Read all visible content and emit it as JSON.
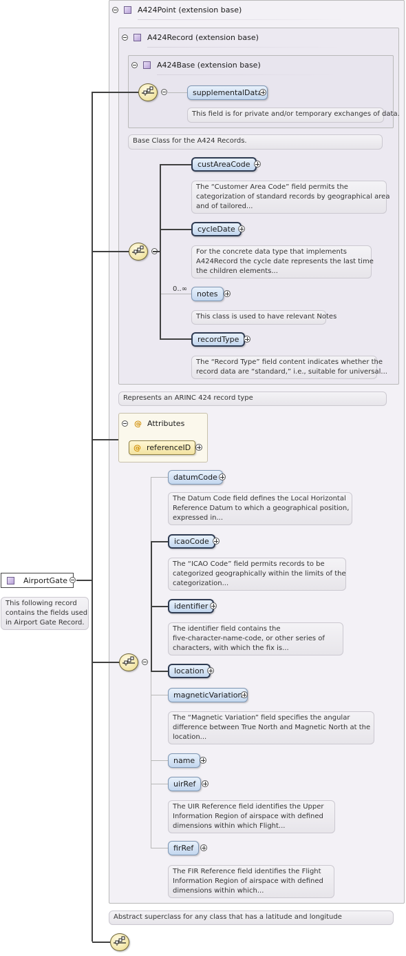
{
  "root": {
    "name": "AirportGate",
    "description": [
      "This following record",
      "contains the fields used",
      "in Airport Gate Record."
    ]
  },
  "groups": {
    "a424point": {
      "title": "A424Point (extension base)",
      "description": "Abstract superclass for any class that has a latitude and longitude"
    },
    "a424record": {
      "title": "A424Record (extension base)",
      "description": "Represents an ARINC 424 record type"
    },
    "a424base": {
      "title": "A424Base (extension base)",
      "description": "Base Class for the A424 Records."
    }
  },
  "base_elements": [
    {
      "name": "supplementalData",
      "description": [
        "This field is for private and/or temporary exchanges of data."
      ]
    }
  ],
  "record_elements": [
    {
      "name": "custAreaCode",
      "description": [
        "The “Customer Area Code” field permits the",
        "categorization of standard records by geographical area",
        "and of tailored..."
      ]
    },
    {
      "name": "cycleDate",
      "description": [
        "For the concrete data type that implements",
        "A424Record the cycle date represents the last time",
        "the children elements..."
      ]
    },
    {
      "name": "notes",
      "occurs": "0..∞",
      "description": [
        "This class is used to have relevant Notes"
      ]
    },
    {
      "name": "recordType",
      "description": [
        "The “Record Type” field content indicates whether the",
        "record data are “standard,” i.e., suitable for universal..."
      ]
    }
  ],
  "attributes": {
    "title": "Attributes",
    "items": [
      {
        "name": "referenceID"
      }
    ]
  },
  "point_elements": [
    {
      "name": "datumCode",
      "description": [
        "The Datum Code field defines the Local Horizontal",
        "Reference Datum to which a geographical position,",
        "expressed in..."
      ]
    },
    {
      "name": "icaoCode",
      "description": [
        "The “ICAO Code” field permits records to be",
        "categorized geographically within the limits of the",
        "categorization..."
      ]
    },
    {
      "name": "identifier",
      "description": [
        "The identifier field contains the",
        "five-character-name-code, or other series of",
        "characters, with which the fix is..."
      ]
    },
    {
      "name": "location"
    },
    {
      "name": "magneticVariation",
      "description": [
        "The “Magnetic Variation” field specifies the angular",
        "difference between True North and Magnetic North at the",
        "location..."
      ]
    },
    {
      "name": "name"
    },
    {
      "name": "uirRef",
      "description": [
        "The UIR Reference field identifies the Upper",
        "Information Region of airspace with defined",
        "dimensions within which Flight..."
      ]
    },
    {
      "name": "firRef",
      "description": [
        "The FIR Reference field identifies the Flight",
        "Information Region of airspace with defined",
        "dimensions within which..."
      ]
    }
  ],
  "icons": {
    "sequence": "sequence-compositor-icon",
    "complex_type": "complex-type-icon",
    "attribute": "attribute-icon",
    "expand": "expand-icon",
    "collapse": "collapse-icon"
  },
  "colors": {
    "element_fill": "#c3d7ef",
    "compositor_fill": "#f1e4a3",
    "group_background": "#f3f1f6",
    "attribute_accent": "#d08c00"
  }
}
